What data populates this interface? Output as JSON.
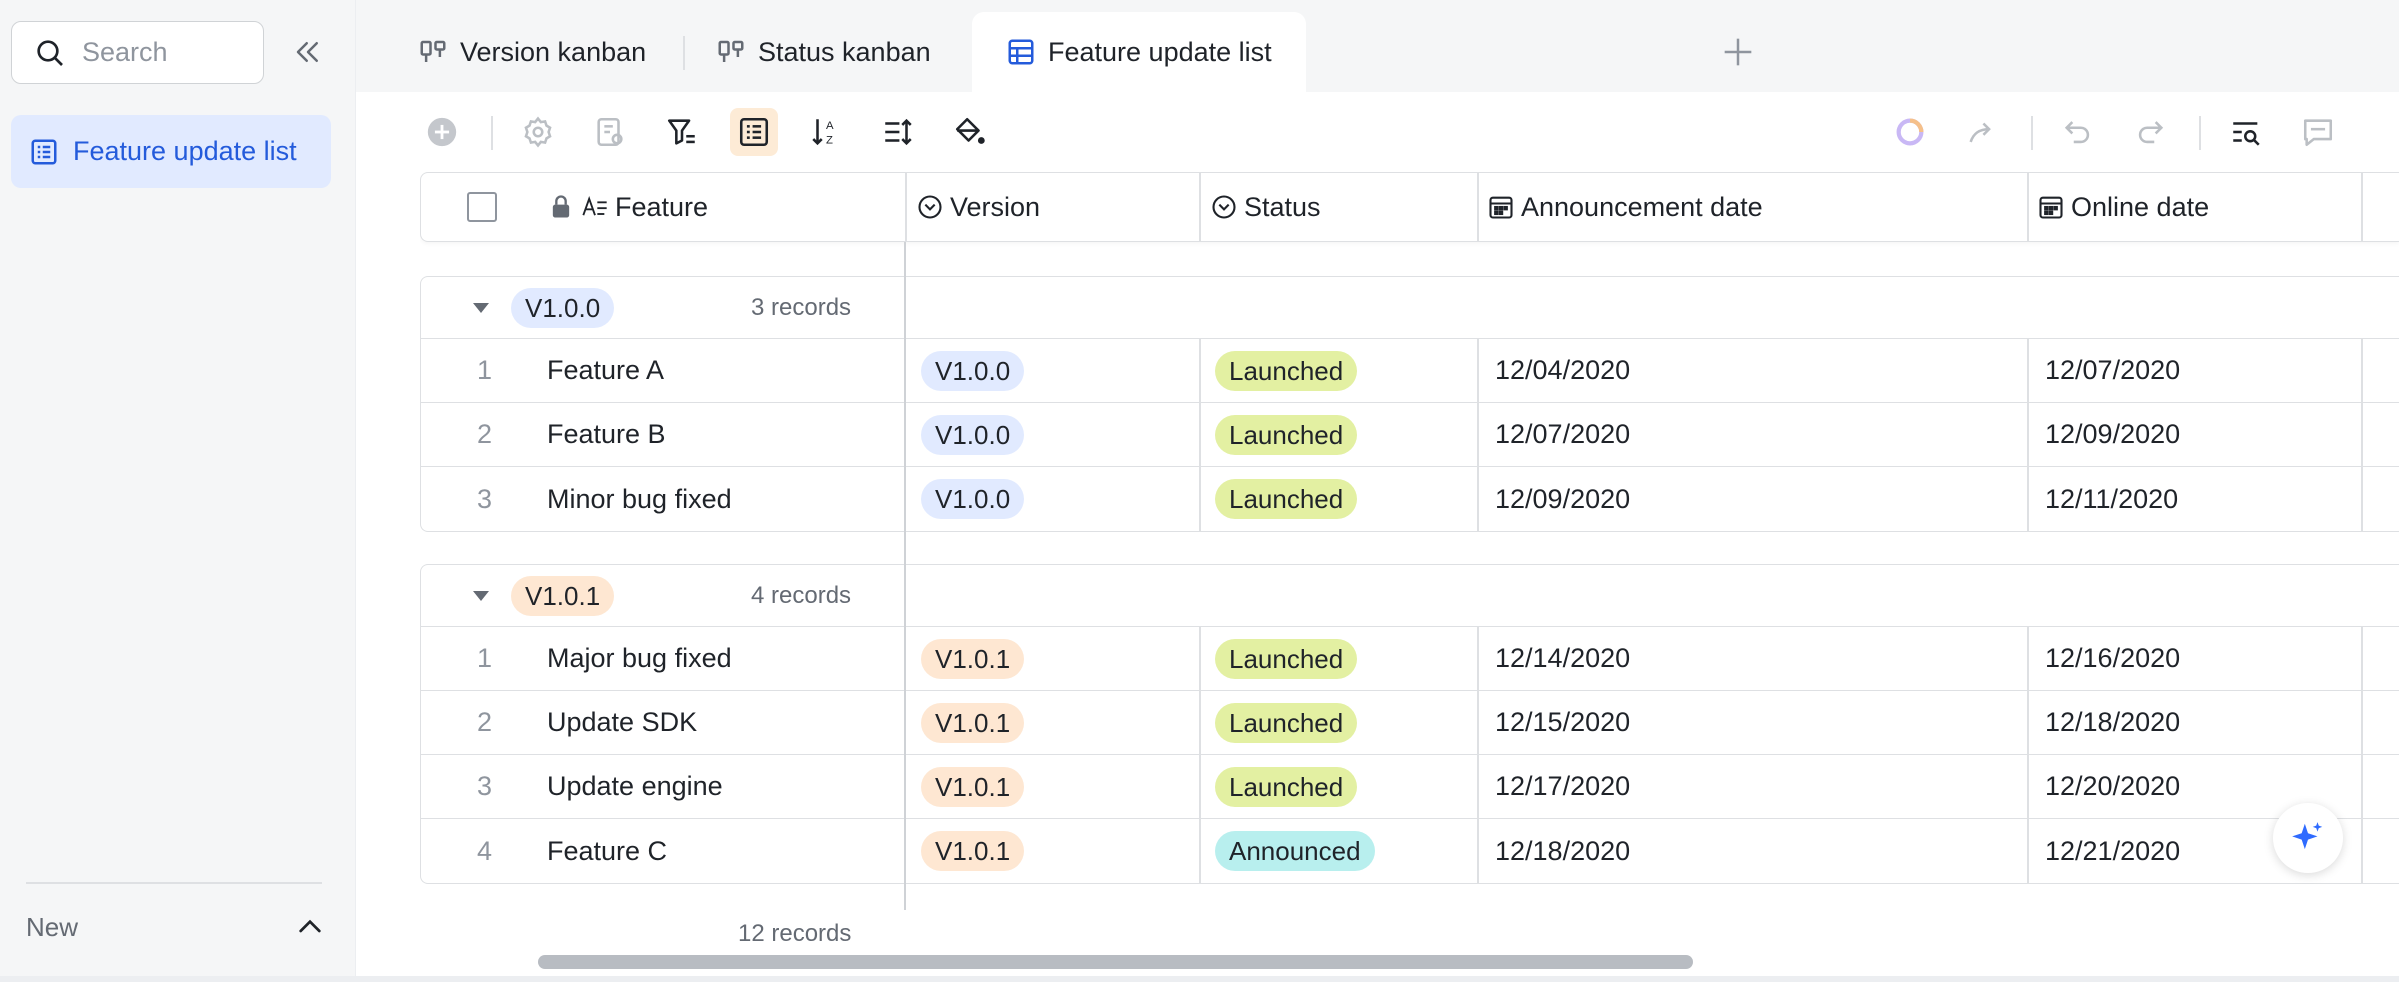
{
  "sidebar": {
    "search_placeholder": "Search",
    "nav_items": [
      {
        "label": "Feature update list"
      }
    ],
    "new_label": "New"
  },
  "tabs": [
    {
      "label": "Version kanban"
    },
    {
      "label": "Status kanban"
    },
    {
      "label": "Feature update list"
    }
  ],
  "table": {
    "columns": [
      {
        "label": "Feature"
      },
      {
        "label": "Version"
      },
      {
        "label": "Status"
      },
      {
        "label": "Announcement date"
      },
      {
        "label": "Online date"
      }
    ],
    "groups": [
      {
        "name": "V1.0.0",
        "count": "3 records",
        "rows": [
          {
            "num": "1",
            "feature": "Feature A",
            "version": "V1.0.0",
            "status": "Launched",
            "announce": "12/04/2020",
            "online": "12/07/2020"
          },
          {
            "num": "2",
            "feature": "Feature B",
            "version": "V1.0.0",
            "status": "Launched",
            "announce": "12/07/2020",
            "online": "12/09/2020"
          },
          {
            "num": "3",
            "feature": "Minor bug fixed",
            "version": "V1.0.0",
            "status": "Launched",
            "announce": "12/09/2020",
            "online": "12/11/2020"
          }
        ]
      },
      {
        "name": "V1.0.1",
        "count": "4 records",
        "rows": [
          {
            "num": "1",
            "feature": "Major bug fixed",
            "version": "V1.0.1",
            "status": "Launched",
            "announce": "12/14/2020",
            "online": "12/16/2020"
          },
          {
            "num": "2",
            "feature": "Update SDK",
            "version": "V1.0.1",
            "status": "Launched",
            "announce": "12/15/2020",
            "online": "12/18/2020"
          },
          {
            "num": "3",
            "feature": "Update engine",
            "version": "V1.0.1",
            "status": "Launched",
            "announce": "12/17/2020",
            "online": "12/20/2020"
          },
          {
            "num": "4",
            "feature": "Feature C",
            "version": "V1.0.1",
            "status": "Announced",
            "announce": "12/18/2020",
            "online": "12/21/2020"
          }
        ]
      }
    ],
    "total": "12 records"
  },
  "colors": {
    "accent": "#245bdb",
    "version_100": "#e1eaff",
    "version_101": "#fee7d2",
    "launched": "#e3f0a2",
    "announced": "#b8efee"
  }
}
